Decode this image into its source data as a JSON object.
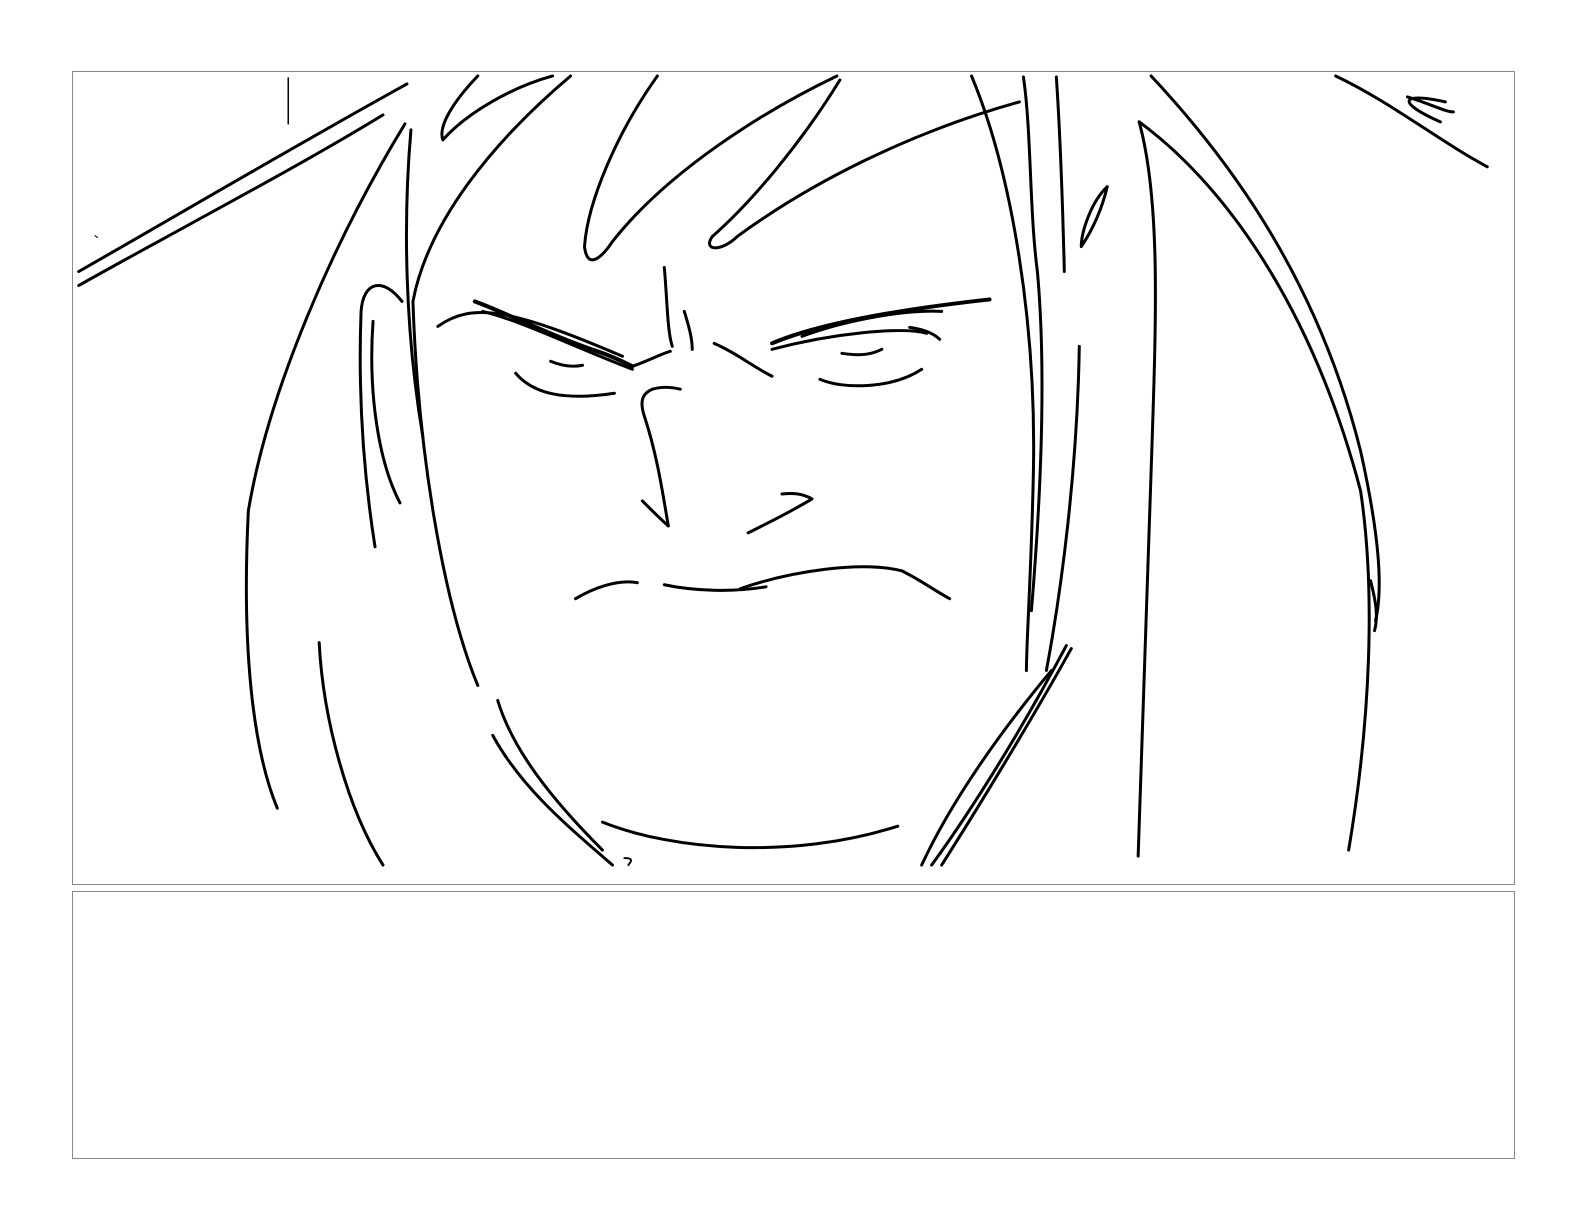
{
  "page": {
    "background": "#ffffff",
    "panel_border_color": "#8a8a8a",
    "ink_color": "#000000"
  },
  "panels": [
    {
      "id": "sketch-panel",
      "content": "sketch-drawing"
    },
    {
      "id": "notes-panel",
      "content": "empty"
    }
  ]
}
